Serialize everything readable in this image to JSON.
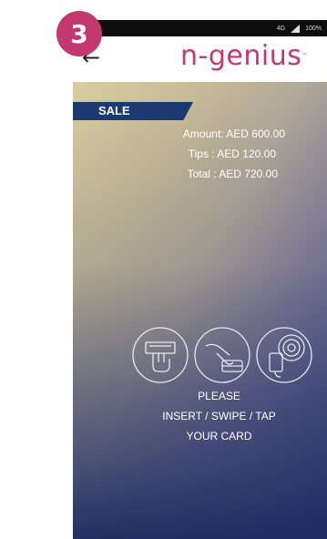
{
  "step_badge": "3",
  "status_bar": {
    "network": "4G",
    "battery": "100%"
  },
  "app_bar": {
    "back_icon": "arrow-left-icon",
    "logo": "n-genius"
  },
  "transaction": {
    "type": "SALE",
    "amount": "Amount: AED  600.00",
    "tips": "Tips : AED  120.00",
    "total": "Total : AED  720.00"
  },
  "card_icons": [
    "insert-card-icon",
    "swipe-card-icon",
    "tap-card-icon"
  ],
  "instructions": [
    "PLEASE",
    "INSERT / SWIPE / TAP",
    "YOUR CARD"
  ],
  "colors": {
    "brand": "#c2386f",
    "sale_tag": "#1c3a72",
    "status_bar": "#0e0e0e"
  }
}
